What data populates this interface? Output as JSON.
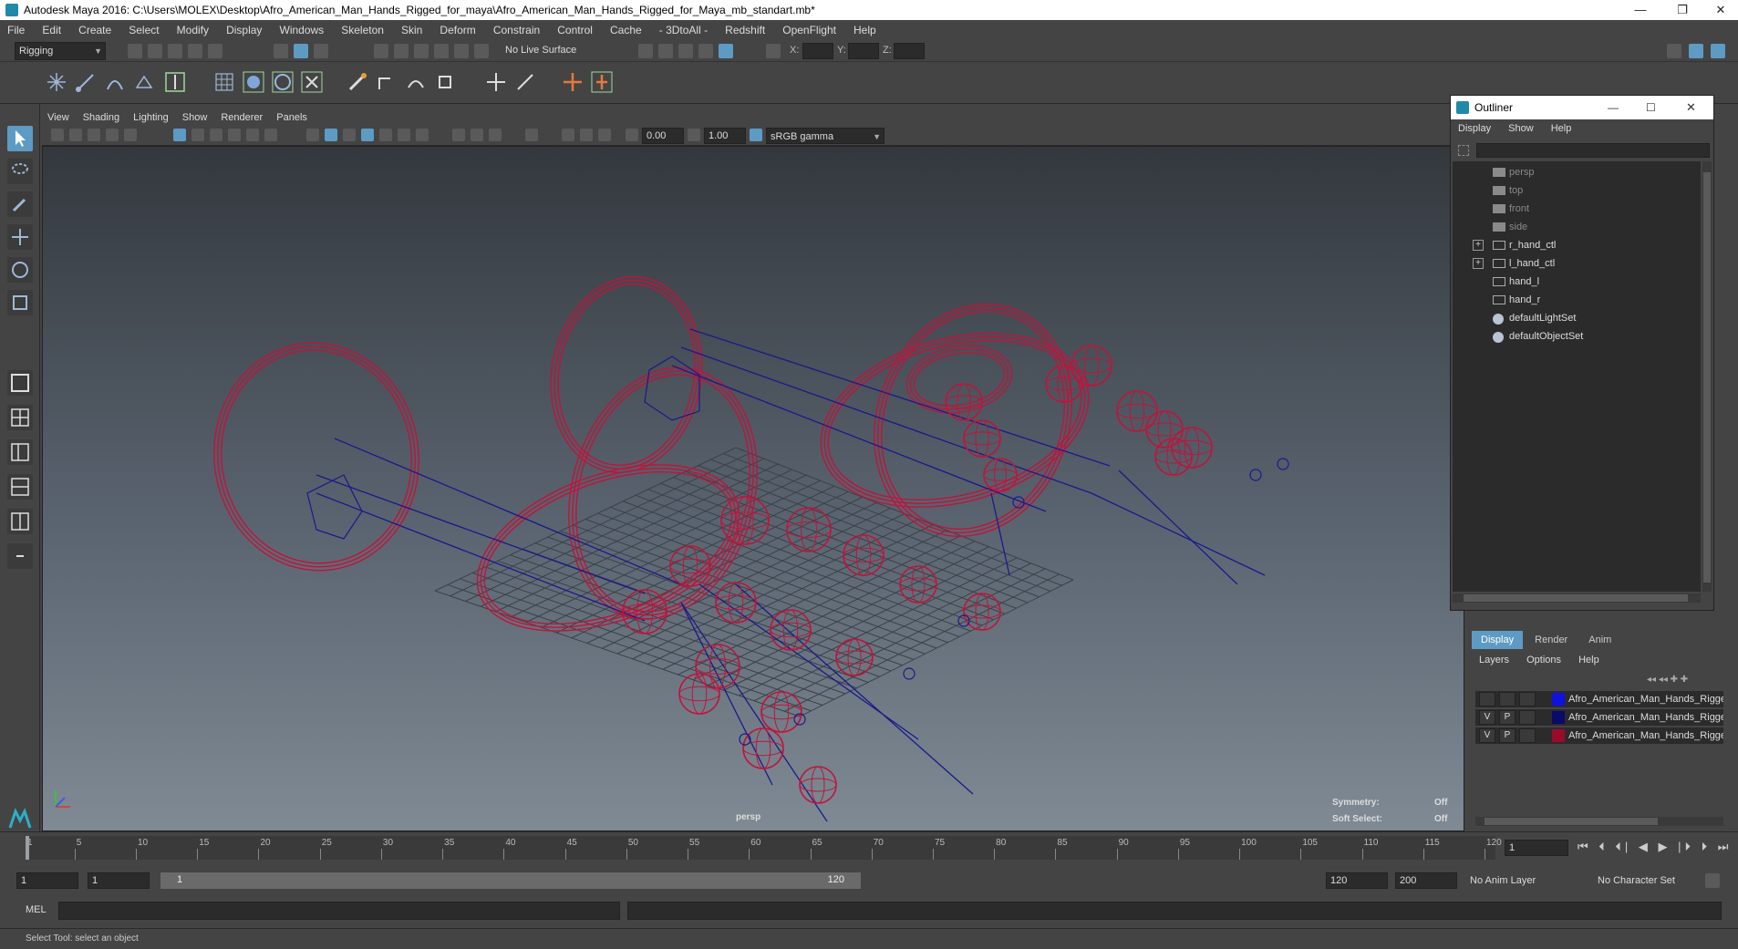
{
  "window": {
    "title": "Autodesk Maya 2016: C:\\Users\\MOLEX\\Desktop\\Afro_American_Man_Hands_Rigged_for_maya\\Afro_American_Man_Hands_Rigged_for_Maya_mb_standart.mb*",
    "minimize": "—",
    "restore": "❐",
    "close": "✕"
  },
  "menubar": [
    "File",
    "Edit",
    "Create",
    "Select",
    "Modify",
    "Display",
    "Windows",
    "Skeleton",
    "Skin",
    "Deform",
    "Constrain",
    "Control",
    "Cache",
    "- 3DtoAll -",
    "Redshift",
    "OpenFlight",
    "Help"
  ],
  "statusline": {
    "menuset": "Rigging",
    "live_surface": "No Live Surface",
    "x_label": "X:",
    "y_label": "Y:",
    "z_label": "Z:"
  },
  "viewport": {
    "menus": [
      "View",
      "Shading",
      "Lighting",
      "Show",
      "Renderer",
      "Panels"
    ],
    "exposure": "0.00",
    "gamma": "1.00",
    "colorspace": "sRGB gamma",
    "camera_label": "persp",
    "symmetry_label": "Symmetry:",
    "symmetry_value": "Off",
    "softselect_label": "Soft Select:",
    "softselect_value": "Off"
  },
  "outliner": {
    "title": "Outliner",
    "menus": [
      "Display",
      "Show",
      "Help"
    ],
    "items": [
      {
        "label": "persp",
        "type": "camera",
        "expandable": false
      },
      {
        "label": "top",
        "type": "camera",
        "expandable": false
      },
      {
        "label": "front",
        "type": "camera",
        "expandable": false
      },
      {
        "label": "side",
        "type": "camera",
        "expandable": false
      },
      {
        "label": "r_hand_ctl",
        "type": "transform",
        "expandable": true
      },
      {
        "label": "l_hand_ctl",
        "type": "transform",
        "expandable": true
      },
      {
        "label": "hand_l",
        "type": "transform",
        "expandable": false
      },
      {
        "label": "hand_r",
        "type": "transform",
        "expandable": false
      },
      {
        "label": "defaultLightSet",
        "type": "set",
        "expandable": false
      },
      {
        "label": "defaultObjectSet",
        "type": "set",
        "expandable": false
      }
    ]
  },
  "layers": {
    "tabs": [
      "Display",
      "Render",
      "Anim"
    ],
    "menus": [
      "Layers",
      "Options",
      "Help"
    ],
    "rows": [
      {
        "v": "",
        "p": "",
        "color": "#1010e0",
        "name": "Afro_American_Man_Hands_Rigged"
      },
      {
        "v": "V",
        "p": "P",
        "color": "#0a0a6a",
        "name": "Afro_American_Man_Hands_Rigged"
      },
      {
        "v": "V",
        "p": "P",
        "color": "#9a0a2a",
        "name": "Afro_American_Man_Hands_Rigged"
      }
    ]
  },
  "timeline": {
    "ticks": [
      "1",
      "5",
      "10",
      "15",
      "20",
      "25",
      "30",
      "35",
      "40",
      "45",
      "50",
      "55",
      "60",
      "65",
      "70",
      "75",
      "80",
      "85",
      "90",
      "95",
      "100",
      "105",
      "110",
      "115",
      "120"
    ],
    "current_frame": "1"
  },
  "range": {
    "start": "1",
    "playback_start": "1",
    "slider_start": "1",
    "slider_end": "120",
    "playback_end": "120",
    "end": "200",
    "anim_layer": "No Anim Layer",
    "character_set": "No Character Set"
  },
  "command": {
    "lang": "MEL"
  },
  "helpline": "Select Tool: select an object",
  "colors": {
    "accent": "#5d9bc4",
    "joint_red": "#c0143c",
    "bone_blue": "#1a1a8a",
    "grid": "#3a4148"
  }
}
